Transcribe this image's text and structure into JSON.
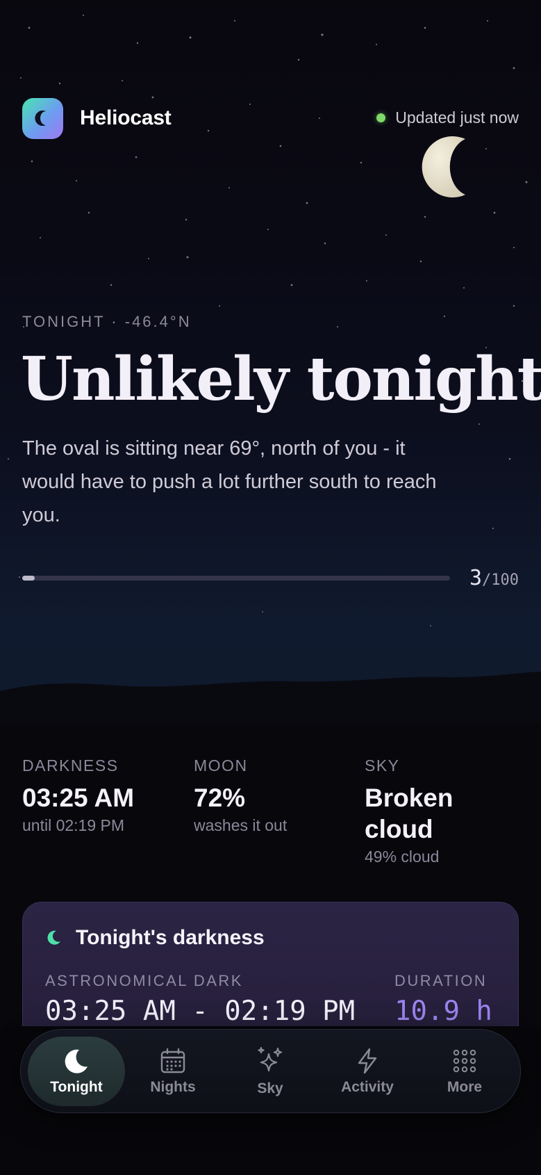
{
  "header": {
    "app_name": "Heliocast",
    "status": "Updated just now"
  },
  "tonight": {
    "eyebrow": "TONIGHT · -46.4°N",
    "headline": "Unlikely tonight",
    "description": "The oval is sitting near 69°, north of you - it would have to push a lot further south to reach you.",
    "score": "3",
    "score_max": "/100",
    "score_fraction": 0.03
  },
  "stats": [
    {
      "label": "DARKNESS",
      "value": "03:25 AM",
      "sub": "until 02:19 PM"
    },
    {
      "label": "MOON",
      "value": "72%",
      "sub": "washes it out"
    },
    {
      "label": "SKY",
      "value": "Broken cloud",
      "sub": "49% cloud"
    }
  ],
  "darkness_card": {
    "title": "Tonight's darkness",
    "astro_label": "ASTRONOMICAL DARK",
    "astro_value": "03:25 AM - 02:19 PM",
    "duration_label": "DURATION",
    "duration_value": "10.9 h"
  },
  "nav": [
    {
      "label": "Tonight",
      "icon": "moon-icon",
      "active": true
    },
    {
      "label": "Nights",
      "icon": "calendar-icon",
      "active": false
    },
    {
      "label": "Sky",
      "icon": "sparkles-icon",
      "active": false
    },
    {
      "label": "Activity",
      "icon": "lightning-icon",
      "active": false
    },
    {
      "label": "More",
      "icon": "grid-dots-icon",
      "active": false
    }
  ],
  "colors": {
    "status_dot": "#7fd86a",
    "accent_green": "#4fe0a8",
    "duration_accent": "#9b84ee",
    "background": "#07070c"
  }
}
